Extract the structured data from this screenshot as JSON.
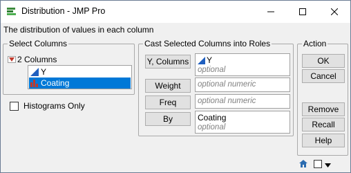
{
  "window": {
    "title": "Distribution - JMP Pro"
  },
  "description": "The distribution of values in each column",
  "select_columns": {
    "title": "Select Columns",
    "count_label": "2 Columns",
    "items": [
      {
        "label": "Y",
        "icon": "continuous-icon"
      },
      {
        "label": "Coating",
        "icon": "nominal-icon",
        "selected": true
      }
    ]
  },
  "histograms_only": {
    "label": "Histograms Only",
    "checked": false
  },
  "cast": {
    "title": "Cast Selected Columns into Roles",
    "roles": [
      {
        "button": "Y, Columns",
        "value": "Y",
        "hint": "optional"
      },
      {
        "button": "Weight",
        "value": "",
        "hint": "optional numeric"
      },
      {
        "button": "Freq",
        "value": "",
        "hint": "optional numeric"
      },
      {
        "button": "By",
        "value": "Coating",
        "hint": "optional"
      }
    ]
  },
  "action": {
    "title": "Action",
    "buttons": [
      "OK",
      "Cancel",
      "Remove",
      "Recall",
      "Help"
    ]
  },
  "colors": {
    "selection": "#0078d7",
    "accent_red": "#c0392b",
    "continuous_blue": "#1f5fbf"
  }
}
